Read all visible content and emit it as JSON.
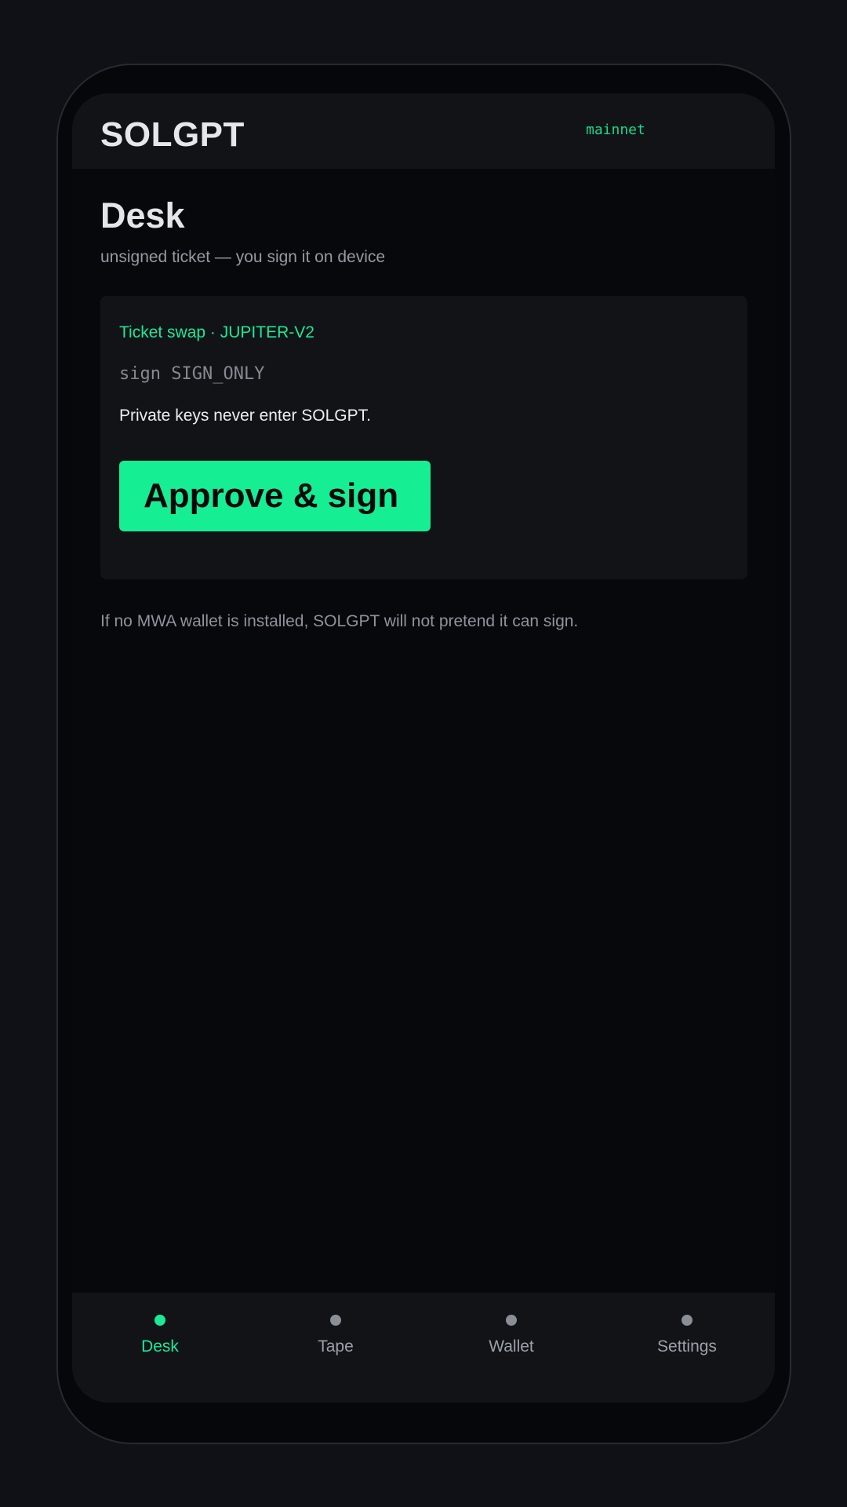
{
  "header": {
    "brand": "SOLGPT",
    "network": "mainnet"
  },
  "desk": {
    "title": "Desk",
    "subtitle": "unsigned ticket — you sign it on device"
  },
  "ticket": {
    "label": "Ticket swap · JUPITER-V2",
    "sign_mode": "sign SIGN_ONLY",
    "keys_note": "Private keys never enter SOLGPT.",
    "approve_label": "Approve & sign"
  },
  "mwa_note": "If no MWA wallet is installed, SOLGPT will not pretend it can sign.",
  "nav": {
    "items": [
      {
        "label": "Desk",
        "active": true
      },
      {
        "label": "Tape",
        "active": false
      },
      {
        "label": "Wallet",
        "active": false
      },
      {
        "label": "Settings",
        "active": false
      }
    ]
  },
  "colors": {
    "accent": "#15ee93",
    "background": "#06080c",
    "surface": "#111317"
  }
}
